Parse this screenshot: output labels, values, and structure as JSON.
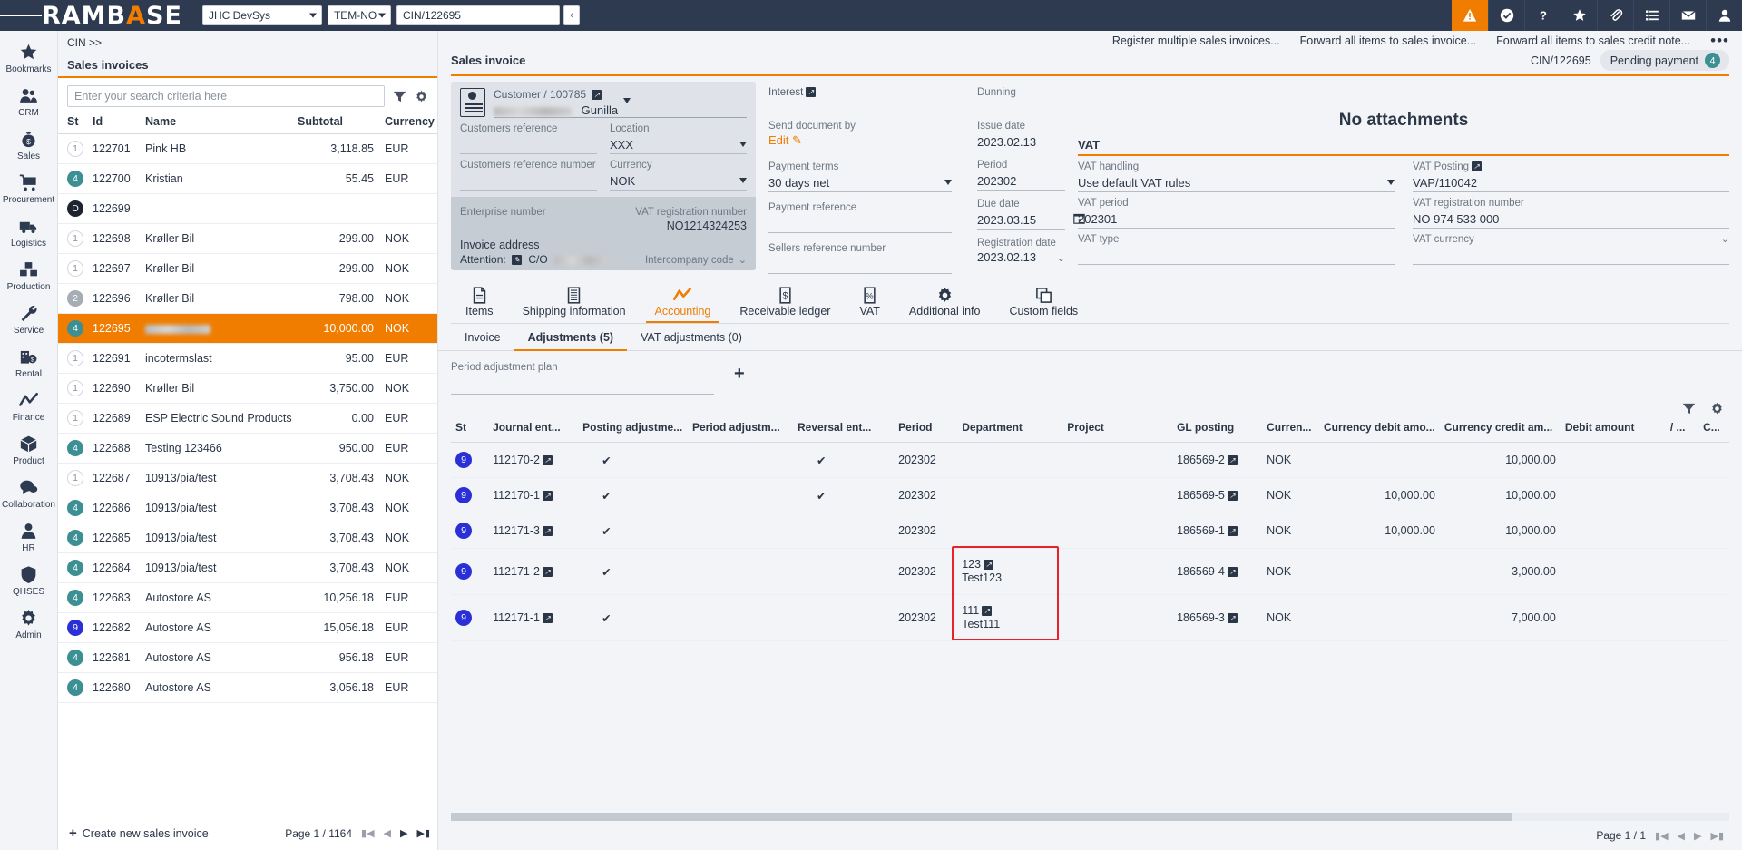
{
  "topbar": {
    "brand_left": "RAMB",
    "brand_accent": "A",
    "brand_right": "SE",
    "company": "JHC DevSys",
    "template": "TEM-NO",
    "document_id": "CIN/122695",
    "back_label": "‹",
    "icons": [
      "alert-icon",
      "check-badge-icon",
      "help-icon",
      "star-icon",
      "attachment-icon",
      "list-icon",
      "mail-icon",
      "user-icon"
    ]
  },
  "leftnav": {
    "items": [
      {
        "label": "Bookmarks",
        "icon": "star-icon"
      },
      {
        "label": "CRM",
        "icon": "people-icon"
      },
      {
        "label": "Sales",
        "icon": "money-bag-icon"
      },
      {
        "label": "Procurement",
        "icon": "cart-icon"
      },
      {
        "label": "Logistics",
        "icon": "truck-icon"
      },
      {
        "label": "Production",
        "icon": "boxes-icon"
      },
      {
        "label": "Service",
        "icon": "wrench-icon"
      },
      {
        "label": "Rental",
        "icon": "building-money-icon"
      },
      {
        "label": "Finance",
        "icon": "chart-line-icon"
      },
      {
        "label": "Product",
        "icon": "cube-icon"
      },
      {
        "label": "Collaboration",
        "icon": "chat-icon"
      },
      {
        "label": "HR",
        "icon": "person-icon"
      },
      {
        "label": "QHSES",
        "icon": "shield-icon"
      },
      {
        "label": "Admin",
        "icon": "gear-icon"
      }
    ]
  },
  "breadcrumb": "CIN >>",
  "list": {
    "title": "Sales invoices",
    "search_placeholder": "Enter your search criteria here",
    "filter_icon": "funnel-icon",
    "settings_icon": "gear-icon",
    "columns": [
      "St",
      "Id",
      "Name",
      "Subtotal",
      "Currency"
    ],
    "rows": [
      {
        "st": "1",
        "cls": "b1",
        "id": "122701",
        "name": "Pink HB",
        "subtotal": "3,118.85",
        "currency": "EUR",
        "selected": false,
        "blur": 0
      },
      {
        "st": "4",
        "cls": "b4",
        "id": "122700",
        "name": "Kristian",
        "subtotal": "55.45",
        "currency": "EUR",
        "selected": false,
        "blur": 0
      },
      {
        "st": "D",
        "cls": "bD",
        "id": "122699",
        "name": "",
        "subtotal": "",
        "currency": "",
        "selected": false,
        "blur": 0
      },
      {
        "st": "1",
        "cls": "b1",
        "id": "122698",
        "name": "Krøller Bil",
        "subtotal": "299.00",
        "currency": "NOK",
        "selected": false,
        "blur": 0
      },
      {
        "st": "1",
        "cls": "b1",
        "id": "122697",
        "name": "Krøller Bil",
        "subtotal": "299.00",
        "currency": "NOK",
        "selected": false,
        "blur": 0
      },
      {
        "st": "2",
        "cls": "b2",
        "id": "122696",
        "name": "Krøller Bil",
        "subtotal": "798.00",
        "currency": "NOK",
        "selected": false,
        "blur": 0
      },
      {
        "st": "4",
        "cls": "b4",
        "id": "122695",
        "name": "",
        "subtotal": "10,000.00",
        "currency": "NOK",
        "selected": true,
        "blur": 72
      },
      {
        "st": "1",
        "cls": "b1",
        "id": "122691",
        "name": "incotermslast",
        "subtotal": "95.00",
        "currency": "EUR",
        "selected": false,
        "blur": 0
      },
      {
        "st": "1",
        "cls": "b1",
        "id": "122690",
        "name": "Krøller Bil",
        "subtotal": "3,750.00",
        "currency": "NOK",
        "selected": false,
        "blur": 0
      },
      {
        "st": "1",
        "cls": "b1",
        "id": "122689",
        "name": "ESP Electric Sound Products",
        "subtotal": "0.00",
        "currency": "EUR",
        "selected": false,
        "blur": 0
      },
      {
        "st": "4",
        "cls": "b4",
        "id": "122688",
        "name": "Testing 123466",
        "subtotal": "950.00",
        "currency": "EUR",
        "selected": false,
        "blur": 0
      },
      {
        "st": "1",
        "cls": "b1",
        "id": "122687",
        "name": "10913/pia/test",
        "subtotal": "3,708.43",
        "currency": "NOK",
        "selected": false,
        "blur": 0
      },
      {
        "st": "4",
        "cls": "b4",
        "id": "122686",
        "name": "10913/pia/test",
        "subtotal": "3,708.43",
        "currency": "NOK",
        "selected": false,
        "blur": 0
      },
      {
        "st": "4",
        "cls": "b4",
        "id": "122685",
        "name": "10913/pia/test",
        "subtotal": "3,708.43",
        "currency": "NOK",
        "selected": false,
        "blur": 0
      },
      {
        "st": "4",
        "cls": "b4",
        "id": "122684",
        "name": "10913/pia/test",
        "subtotal": "3,708.43",
        "currency": "NOK",
        "selected": false,
        "blur": 0
      },
      {
        "st": "4",
        "cls": "b4",
        "id": "122683",
        "name": "Autostore AS",
        "subtotal": "10,256.18",
        "currency": "EUR",
        "selected": false,
        "blur": 0
      },
      {
        "st": "9",
        "cls": "b9",
        "id": "122682",
        "name": "Autostore AS",
        "subtotal": "15,056.18",
        "currency": "EUR",
        "selected": false,
        "blur": 0
      },
      {
        "st": "4",
        "cls": "b4",
        "id": "122681",
        "name": "Autostore AS",
        "subtotal": "956.18",
        "currency": "EUR",
        "selected": false,
        "blur": 0
      },
      {
        "st": "4",
        "cls": "b4",
        "id": "122680",
        "name": "Autostore AS",
        "subtotal": "3,056.18",
        "currency": "EUR",
        "selected": false,
        "blur": 0
      }
    ],
    "create_label": "Create new sales invoice",
    "page_label": "Page 1 / 1164"
  },
  "detail": {
    "actions": [
      "Register multiple sales invoices...",
      "Forward all items to sales invoice...",
      "Forward all items to sales credit note..."
    ],
    "more_label": "•••",
    "title": "Sales invoice",
    "doc_id": "CIN/122695",
    "status_pill": "Pending payment",
    "status_count": "4",
    "customer": {
      "label": "Customer / 100785",
      "name_blurred": true,
      "name": "Gunilla"
    },
    "fields": {
      "customers_reference_label": "Customers reference",
      "customers_reference": "",
      "customers_reference_number_label": "Customers reference number",
      "customers_reference_number": "",
      "location_label": "Location",
      "location": "XXX",
      "currency_label": "Currency",
      "currency": "NOK",
      "enterprise_number_label": "Enterprise number",
      "enterprise_number": "",
      "vat_registration_number_label": "VAT registration number",
      "vat_registration_number": "NO1214324253",
      "invoice_address_label": "Invoice address",
      "attention_label": "Attention:",
      "attention_co": "C/O",
      "intercompany_code_label": "Intercompany code",
      "interest_label": "Interest",
      "send_document_by_label": "Send document by",
      "send_document_by_edit": "Edit",
      "payment_terms_label": "Payment terms",
      "payment_terms": "30 days net",
      "payment_reference_label": "Payment reference",
      "payment_reference": "",
      "sellers_reference_number_label": "Sellers reference number",
      "sellers_reference_number": "",
      "dunning_label": "Dunning",
      "dunning": "",
      "issue_date_label": "Issue date",
      "issue_date": "2023.02.13",
      "period_label": "Period",
      "period": "202302",
      "due_date_label": "Due date",
      "due_date": "2023.03.15",
      "registration_date_label": "Registration date",
      "registration_date": "2023.02.13"
    },
    "attachments_text": "No attachments",
    "vat": {
      "section_title": "VAT",
      "handling_label": "VAT handling",
      "handling": "Use default VAT rules",
      "posting_label": "VAT Posting",
      "posting": "VAP/110042",
      "period_label": "VAT period",
      "period": "202301",
      "registration_number_label": "VAT registration number",
      "registration_number": "NO 974 533 000",
      "type_label": "VAT type",
      "type": "",
      "currency_label": "VAT currency",
      "currency": ""
    },
    "tabs": [
      {
        "label": "Items",
        "icon": "document-icon",
        "active": false
      },
      {
        "label": "Shipping information",
        "icon": "grid-document-icon",
        "active": false
      },
      {
        "label": "Accounting",
        "icon": "chart-line-icon",
        "active": true
      },
      {
        "label": "Receivable ledger",
        "icon": "dollar-document-icon",
        "active": false
      },
      {
        "label": "VAT",
        "icon": "percent-document-icon",
        "active": false
      },
      {
        "label": "Additional info",
        "icon": "gear-icon",
        "active": false
      },
      {
        "label": "Custom fields",
        "icon": "copy-icon",
        "active": false
      }
    ],
    "subtabs": [
      {
        "label": "Invoice",
        "active": false
      },
      {
        "label": "Adjustments (5)",
        "active": true
      },
      {
        "label": "VAT adjustments (0)",
        "active": false
      }
    ],
    "plan_label": "Period adjustment plan",
    "plan_value": "",
    "add_icon": "plus-icon",
    "grid_filter_icon": "funnel-icon",
    "grid_settings_icon": "gear-icon",
    "grid": {
      "columns": [
        "St",
        "Journal ent...",
        "Posting adjustme...",
        "Period adjustm...",
        "Reversal ent...",
        "Period",
        "Department",
        "Project",
        "GL posting",
        "Curren...",
        "Currency debit amo...",
        "Currency credit am...",
        "Debit amount",
        "/ ...",
        "C..."
      ],
      "rows": [
        {
          "st": "9",
          "journal": "112170-2",
          "posting_adj": "✔",
          "period_adj": "",
          "reversal": "✔",
          "period": "202302",
          "dept_code": "",
          "dept_name": "",
          "project": "",
          "gl": "186569-2",
          "currency": "NOK",
          "cur_debit": "",
          "cur_credit": "10,000.00",
          "debit": "",
          "credit": ""
        },
        {
          "st": "9",
          "journal": "112170-1",
          "posting_adj": "✔",
          "period_adj": "",
          "reversal": "✔",
          "period": "202302",
          "dept_code": "",
          "dept_name": "",
          "project": "",
          "gl": "186569-5",
          "currency": "NOK",
          "cur_debit": "10,000.00",
          "cur_credit": "10,000.00",
          "debit": "",
          "credit": ""
        },
        {
          "st": "9",
          "journal": "112171-3",
          "posting_adj": "✔",
          "period_adj": "",
          "reversal": "",
          "period": "202302",
          "dept_code": "",
          "dept_name": "",
          "project": "",
          "gl": "186569-1",
          "currency": "NOK",
          "cur_debit": "10,000.00",
          "cur_credit": "10,000.00",
          "debit": "",
          "credit": ""
        },
        {
          "st": "9",
          "journal": "112171-2",
          "posting_adj": "✔",
          "period_adj": "",
          "reversal": "",
          "period": "202302",
          "dept_code": "123",
          "dept_name": "Test123",
          "project": "",
          "gl": "186569-4",
          "currency": "NOK",
          "cur_debit": "",
          "cur_credit": "3,000.00",
          "debit": "",
          "credit": ""
        },
        {
          "st": "9",
          "journal": "112171-1",
          "posting_adj": "✔",
          "period_adj": "",
          "reversal": "",
          "period": "202302",
          "dept_code": "111",
          "dept_name": "Test111",
          "project": "",
          "gl": "186569-3",
          "currency": "NOK",
          "cur_debit": "",
          "cur_credit": "7,000.00",
          "debit": "",
          "credit": ""
        }
      ]
    },
    "grid_page_label": "Page 1 / 1"
  },
  "colors": {
    "accent": "#f07d00",
    "navy": "#2e3a4f",
    "teal": "#3c8f92",
    "blue": "#2b2fd6",
    "highlight_red": "#e8212a"
  }
}
